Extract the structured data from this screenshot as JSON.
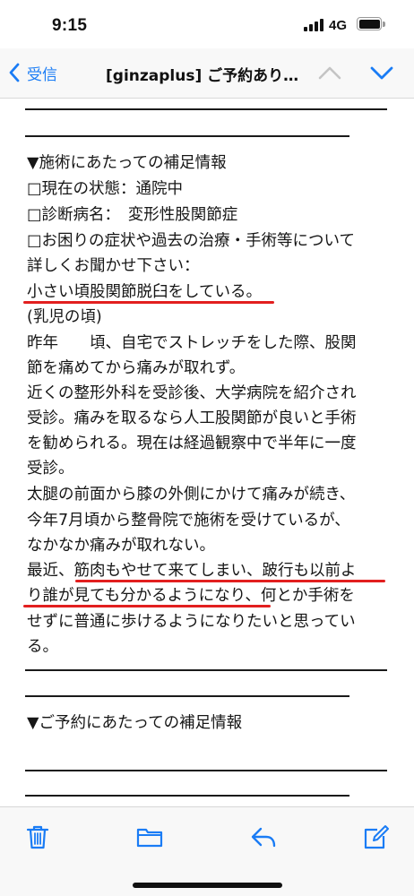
{
  "status_bar": {
    "time": "9:15",
    "network": "4G"
  },
  "nav": {
    "back_label": "受信",
    "title": "[ginzaplus] ご予約あり…",
    "icons": [
      "chevron-left-icon",
      "chevron-up-icon",
      "chevron-down-icon"
    ]
  },
  "body": {
    "lines": [
      "▼施術にあたっての補足情報",
      "□現在の状態：通院中",
      "□診断病名：　変形性股関節症",
      "□お困りの症状や過去の治療・手術等について",
      "詳しくお聞かせ下さい：",
      "小さい頃股関節脱臼をしている。",
      "(乳児の頃)",
      "昨年　　頃、自宅でストレッチをした際、股関",
      "節を痛めてから痛みが取れず。",
      "近くの整形外科を受診後、大学病院を紹介され",
      "受診。痛みを取るなら人工股関節が良いと手術",
      "を勧められる。現在は経過観察中で半年に一度",
      "受診。",
      "太腿の前面から膝の外側にかけて痛みが続き、",
      "今年7月頃から整骨院で施術を受けているが、",
      "なかなか痛みが取れない。",
      "最近、筋肉もやせて来てしまい、跛行も以前よ",
      "り誰が見ても分かるようになり、何とか手術を",
      "せずに普通に歩けるようになりたいと思ってい",
      "る。"
    ],
    "section2_heading": "▼ご予約にあたっての補足情報"
  },
  "highlight_color": "#e21f1f",
  "accent_color": "#1a7cf5",
  "toolbar": {
    "icons": [
      "trash-icon",
      "folder-icon",
      "reply-icon",
      "compose-icon"
    ]
  }
}
